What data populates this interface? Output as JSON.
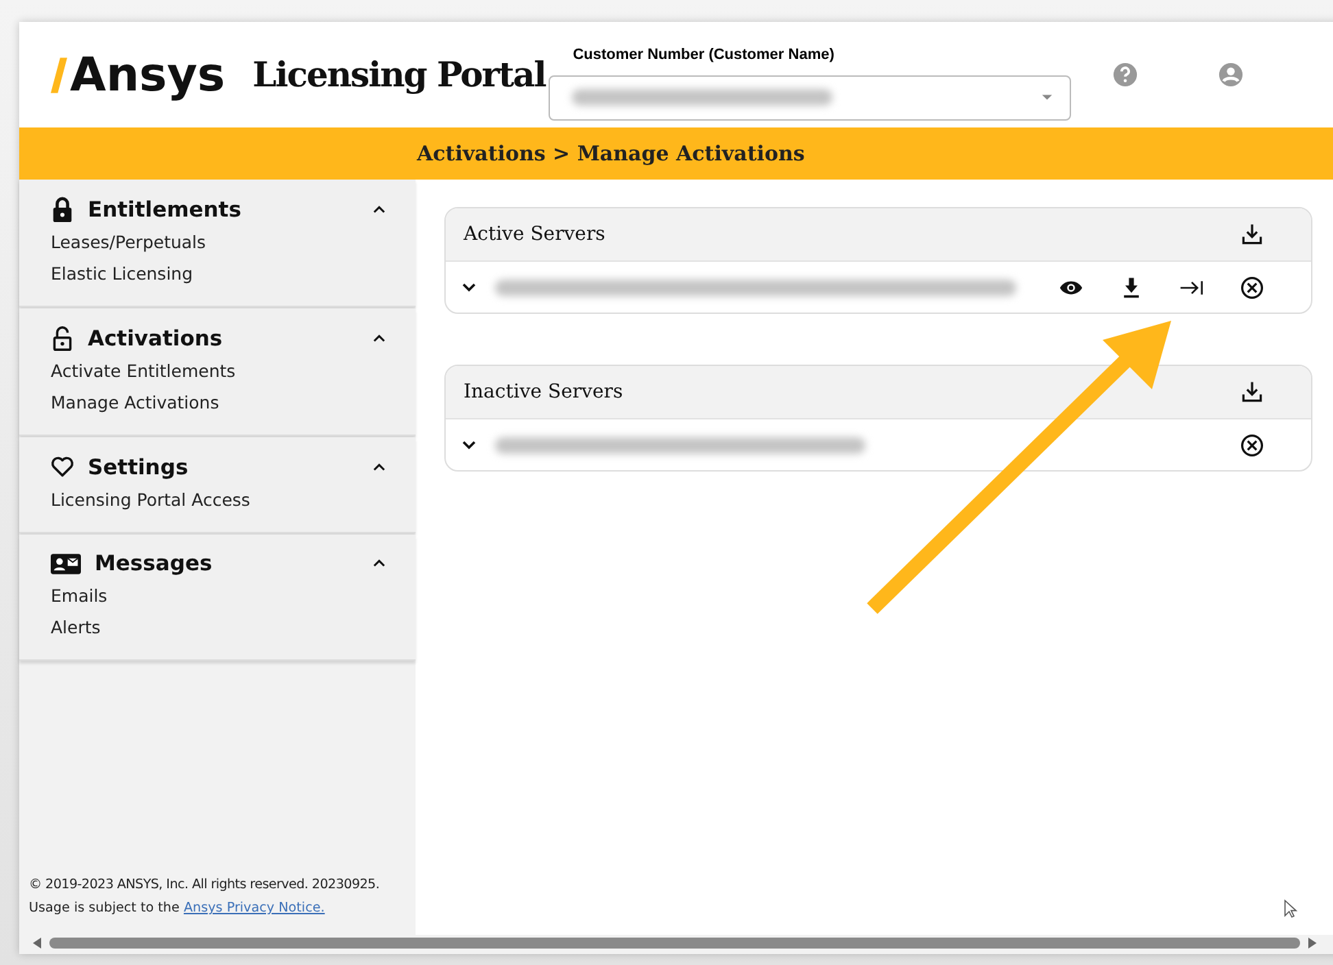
{
  "header": {
    "logo": "Ansys",
    "title": "Licensing Portal",
    "customer_label": "Customer Number (Customer Name)"
  },
  "breadcrumb": "Activations > Manage Activations",
  "sidebar": [
    {
      "title": "Entitlements",
      "expanded": true,
      "items": [
        "Leases/Perpetuals",
        "Elastic Licensing"
      ]
    },
    {
      "title": "Activations",
      "expanded": true,
      "items": [
        "Activate Entitlements",
        "Manage Activations"
      ]
    },
    {
      "title": "Settings",
      "expanded": true,
      "items": [
        "Licensing Portal Access"
      ]
    },
    {
      "title": "Messages",
      "expanded": true,
      "items": [
        "Emails",
        "Alerts"
      ]
    }
  ],
  "footer": {
    "copyright": "© 2019-2023 ANSYS, Inc. All rights reserved. 20230925.",
    "notice": "Usage is subject to the",
    "link": "Ansys Privacy Notice."
  },
  "panels": [
    {
      "title": "Active Servers",
      "kind": "active"
    },
    {
      "title": "Inactive Servers",
      "kind": "inactive"
    }
  ]
}
